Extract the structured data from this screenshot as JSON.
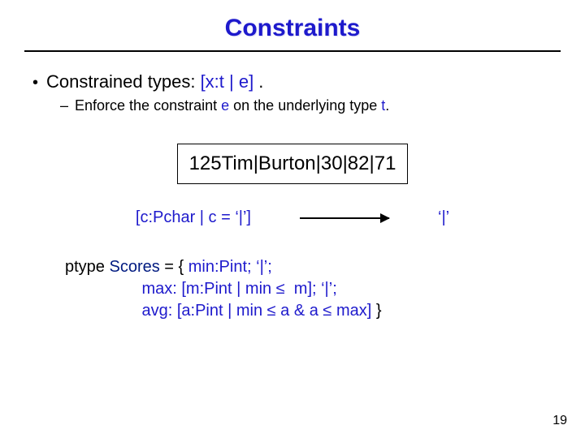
{
  "title": "Constraints",
  "bullet": {
    "prefix": "Constrained types: ",
    "code": "[x:t | e]",
    "suffix": " ."
  },
  "subbullet": {
    "t1": "Enforce the constraint ",
    "e": "e",
    "t2": " on the underlying type ",
    "ttype": "t",
    "t3": "."
  },
  "example": "125Tim|Burton|30|82|71",
  "constraint_expr": "[c:Pchar | c = ‘|’]",
  "result": "‘|’",
  "ptype": {
    "l1a": "ptype ",
    "l1b": "Scores",
    "l1c": " = { ",
    "l1d": "min:Pint; ‘|’;",
    "l2": "max: [m:Pint | min ≤  m]; ‘|’;",
    "l3": "avg: [a:Pint | min ≤ a & a ≤ max]",
    "l3b": " }"
  },
  "page_number": "19"
}
